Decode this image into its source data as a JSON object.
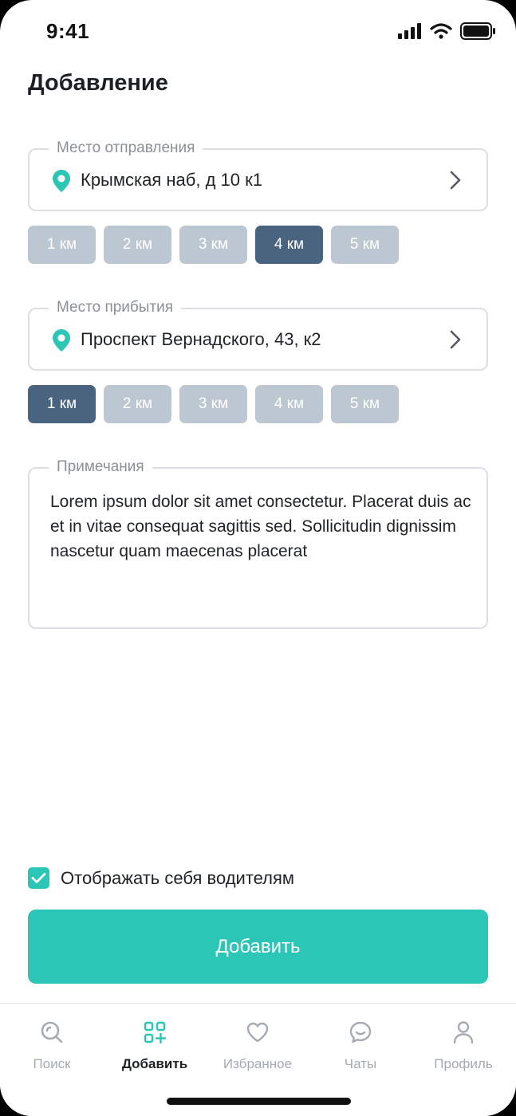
{
  "status": {
    "time": "9:41"
  },
  "page": {
    "title": "Добавление"
  },
  "departure": {
    "legend": "Место отправления",
    "value": "Крымская наб, д 10 к1",
    "chips": [
      "1 км",
      "2 км",
      "3 км",
      "4 км",
      "5 км"
    ],
    "selected_index": 3
  },
  "arrival": {
    "legend": "Место прибытия",
    "value": "Проспект Вернадского, 43, к2",
    "chips": [
      "1 км",
      "2 км",
      "3 км",
      "4 км",
      "5 км"
    ],
    "selected_index": 0
  },
  "notes": {
    "legend": "Примечания",
    "text": "Lorem ipsum dolor sit amet consectetur. Placerat duis ac et in vitae consequat sagittis sed. Sollicitudin dignissim nascetur quam maecenas placerat"
  },
  "visibility": {
    "label": "Отображать себя водителям",
    "checked": true
  },
  "submit": {
    "label": "Добавить"
  },
  "tabs": [
    {
      "label": "Поиск",
      "icon": "search-icon",
      "active": false
    },
    {
      "label": "Добавить",
      "icon": "add-grid-icon",
      "active": true
    },
    {
      "label": "Избранное",
      "icon": "heart-icon",
      "active": false
    },
    {
      "label": "Чаты",
      "icon": "chat-icon",
      "active": false
    },
    {
      "label": "Профиль",
      "icon": "profile-icon",
      "active": false
    }
  ],
  "colors": {
    "accent": "#2bc6b5",
    "chip_active": "#4a6480",
    "chip_inactive": "#bdc7d1"
  }
}
